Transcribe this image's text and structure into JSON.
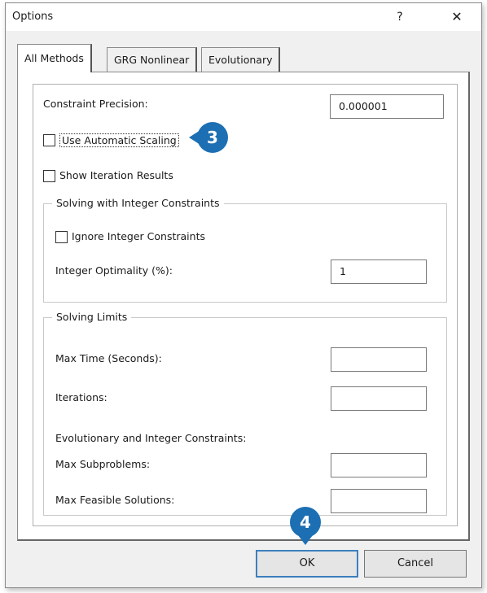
{
  "window": {
    "title": "Options",
    "help_glyph": "?",
    "close_glyph": "✕"
  },
  "tabs": [
    {
      "label": "All Methods",
      "active": true
    },
    {
      "label": "GRG Nonlinear",
      "active": false
    },
    {
      "label": "Evolutionary",
      "active": false
    }
  ],
  "all_methods": {
    "constraint_precision": {
      "label": "Constraint Precision:",
      "value": "0.000001"
    },
    "use_automatic_scaling": {
      "label": "Use Automatic Scaling",
      "checked": false
    },
    "show_iteration_results": {
      "label": "Show Iteration Results",
      "checked": false
    },
    "integer_group": {
      "title": "Solving with Integer Constraints",
      "ignore_integer": {
        "label": "Ignore Integer Constraints",
        "checked": false
      },
      "integer_optimality": {
        "label": "Integer Optimality (%):",
        "value": "1"
      }
    },
    "limits_group": {
      "title": "Solving Limits",
      "max_time": {
        "label": "Max Time (Seconds):",
        "value": ""
      },
      "iterations": {
        "label": "Iterations:",
        "value": ""
      },
      "evo_heading": "Evolutionary and Integer Constraints:",
      "max_subproblems": {
        "label": "Max Subproblems:",
        "value": ""
      },
      "max_feasible": {
        "label": "Max Feasible Solutions:",
        "value": ""
      }
    }
  },
  "buttons": {
    "ok": "OK",
    "cancel": "Cancel"
  },
  "callouts": {
    "scaling": "3",
    "ok": "4"
  },
  "colors": {
    "callout": "#1c6fb3",
    "ok_focus_border": "#3c7fbf"
  }
}
